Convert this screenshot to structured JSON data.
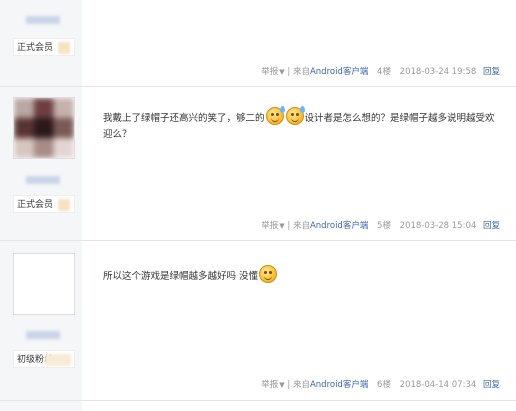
{
  "posts": [
    {
      "rank": "正式会员",
      "content": [],
      "report": "举报",
      "source_prefix": "来自",
      "source": "Android客户端",
      "floor": "4楼",
      "time": "2018-03-24 19:58",
      "reply": "回复"
    },
    {
      "rank": "正式会员",
      "content_a": "我戴上了绿帽子还高兴的笑了，够二的",
      "content_b": "设计者是怎么想的？是绿帽子越多说明越受欢迎么？",
      "emoji": [
        "sweat-smile-emoji",
        "sweat-smile-emoji"
      ],
      "report": "举报",
      "source_prefix": "来自",
      "source": "Android客户端",
      "floor": "5楼",
      "time": "2018-03-28 15:04",
      "reply": "回复"
    },
    {
      "rank": "初级粉丝",
      "content_a": "所以这个游戏是绿帽越多越好吗 没懂",
      "emoji": [
        "smile-emoji"
      ],
      "report": "举报",
      "source_prefix": "来自",
      "source": "Android客户端",
      "floor": "6楼",
      "time": "2018-04-14 07:34",
      "reply": "回复"
    }
  ],
  "separator": "|"
}
